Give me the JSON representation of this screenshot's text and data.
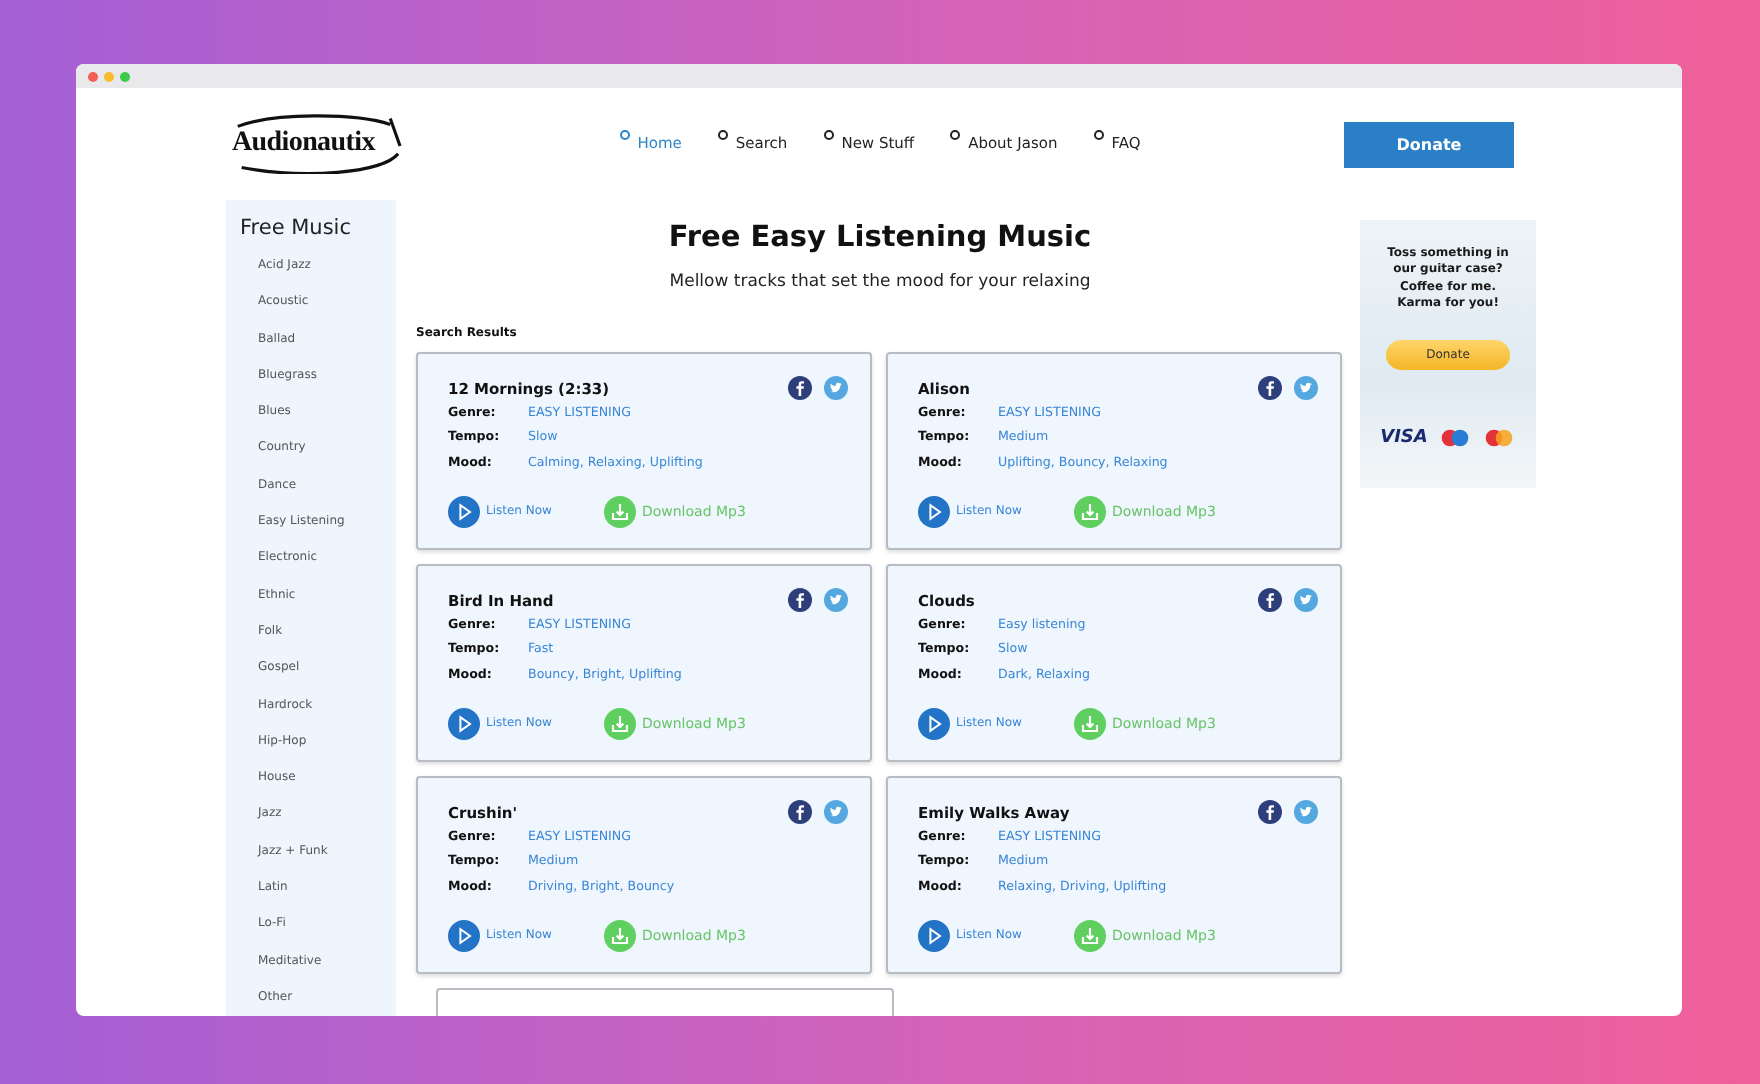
{
  "logo": {
    "text": "Audionautix"
  },
  "nav": [
    {
      "label": "Home",
      "selected": true
    },
    {
      "label": "Search",
      "selected": false
    },
    {
      "label": "New Stuff",
      "selected": false
    },
    {
      "label": "About Jason",
      "selected": false
    },
    {
      "label": "FAQ",
      "selected": false
    }
  ],
  "donate_button": "Donate",
  "sidebar": {
    "title": "Free Music",
    "items": [
      "Acid Jazz",
      "Acoustic",
      "Ballad",
      "Bluegrass",
      "Blues",
      "Country",
      "Dance",
      "Easy Listening",
      "Electronic",
      "Ethnic",
      "Folk",
      "Gospel",
      "Hardrock",
      "Hip-Hop",
      "House",
      "Jazz",
      "Jazz + Funk",
      "Latin",
      "Lo-Fi",
      "Meditative",
      "Other"
    ]
  },
  "page_title": "Free Easy Listening Music",
  "subtitle": "Mellow tracks that set the mood for your relaxing",
  "results_label": "Search Results",
  "results": [
    {
      "title": "12 Mornings (2:33)",
      "fields": [
        {
          "label": "Genre:",
          "value": "EASY LISTENING"
        },
        {
          "label": "Tempo:",
          "value": "Slow"
        },
        {
          "label": "Mood:",
          "value": "Calming, Relaxing, Uplifting"
        }
      ],
      "listen": "Listen Now",
      "download": "Download Mp3"
    },
    {
      "title": "Alison",
      "fields": [
        {
          "label": "Genre:",
          "value": "EASY LISTENING"
        },
        {
          "label": "Tempo:",
          "value": "Medium"
        },
        {
          "label": "Mood:",
          "value": "Uplifting, Bouncy, Relaxing"
        }
      ],
      "listen": "Listen Now",
      "download": "Download Mp3"
    },
    {
      "title": "Bird In Hand",
      "fields": [
        {
          "label": "Genre:",
          "value": "EASY LISTENING"
        },
        {
          "label": "Tempo:",
          "value": "Fast"
        },
        {
          "label": "Mood:",
          "value": "Bouncy, Bright, Uplifting"
        }
      ],
      "listen": "Listen Now",
      "download": "Download Mp3"
    },
    {
      "title": "Clouds",
      "fields": [
        {
          "label": "Genre:",
          "value": "Easy listening"
        },
        {
          "label": "Tempo:",
          "value": "Slow"
        },
        {
          "label": "Mood:",
          "value": "Dark, Relaxing"
        }
      ],
      "listen": "Listen Now",
      "download": "Download Mp3"
    },
    {
      "title": "Crushin'",
      "fields": [
        {
          "label": "Genre:",
          "value": "EASY LISTENING"
        },
        {
          "label": "Tempo:",
          "value": "Medium"
        },
        {
          "label": "Mood:",
          "value": "Driving, Bright, Bouncy"
        }
      ],
      "listen": "Listen Now",
      "download": "Download Mp3"
    },
    {
      "title": "Emily Walks Away",
      "fields": [
        {
          "label": "Genre:",
          "value": "EASY LISTENING"
        },
        {
          "label": "Tempo:",
          "value": "Medium"
        },
        {
          "label": "Mood:",
          "value": "Relaxing, Driving, Uplifting"
        }
      ],
      "listen": "Listen Now",
      "download": "Download Mp3"
    }
  ],
  "ad": {
    "text": "Toss something in our guitar case? Coffee for me. Karma for you!",
    "button": "Donate",
    "card_brand": "VISA"
  }
}
